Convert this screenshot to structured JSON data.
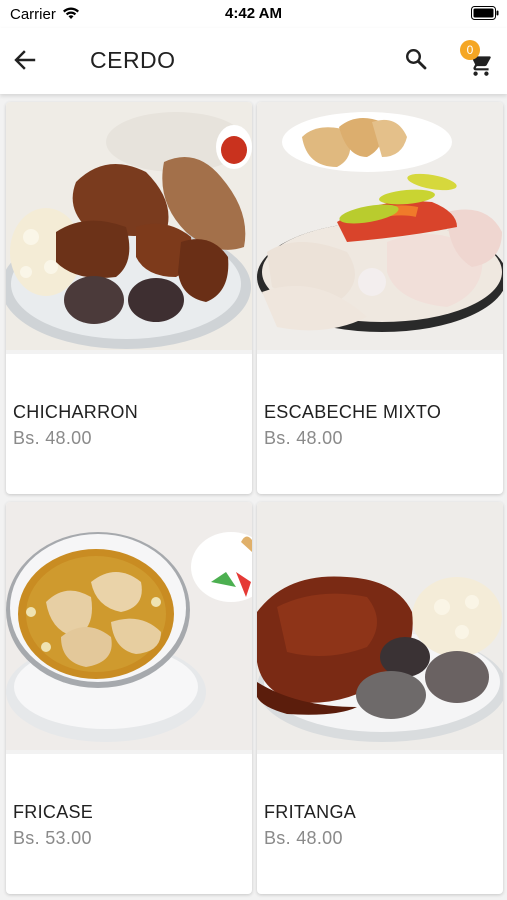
{
  "status_bar": {
    "carrier": "Carrier",
    "time": "4:42 AM"
  },
  "header": {
    "title": "CERDO",
    "cart_count": "0"
  },
  "colors": {
    "badge": "#f5a623",
    "price_text": "#8a8a8a",
    "title_text": "#212121"
  },
  "icons": {
    "back": "arrow-left-icon",
    "search": "search-icon",
    "cart": "shopping-cart-icon"
  },
  "products": [
    {
      "name": "CHICHARRON",
      "price": "Bs. 48.00"
    },
    {
      "name": "ESCABECHE MIXTO",
      "price": "Bs. 48.00"
    },
    {
      "name": "FRICASE",
      "price": "Bs. 53.00"
    },
    {
      "name": "FRITANGA",
      "price": "Bs. 48.00"
    }
  ]
}
